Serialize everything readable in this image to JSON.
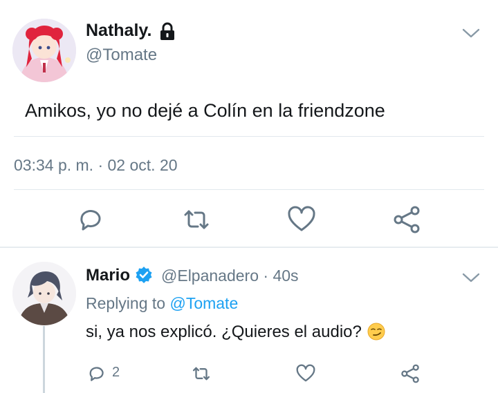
{
  "main_tweet": {
    "name": "Nathaly.",
    "handle": "@Tomate",
    "text": "Amikos, yo no dejé a Colín en la friendzone",
    "timestamp": "03:34 p. m. · 02 oct. 20",
    "icons": [
      "lock-icon",
      "chevron-down-icon",
      "reply-icon",
      "retweet-icon",
      "like-icon",
      "share-icon"
    ]
  },
  "reply_tweet": {
    "name": "Mario",
    "handle_meta": "@Elpanadero · 40s",
    "replying_prefix": "Replying to",
    "replying_handle": "@Tomate",
    "text": "si, ya nos explicó. ¿Quieres el audio?",
    "emoji": "smirk-emoji",
    "reply_count": "2",
    "icons": [
      "verified-icon",
      "chevron-down-icon",
      "reply-icon",
      "retweet-icon",
      "like-icon",
      "share-icon"
    ]
  },
  "colors": {
    "text": "#14171a",
    "secondary": "#657786",
    "link": "#1da1f2",
    "verified": "#1da1f2",
    "divider": "#e1e8ed"
  }
}
